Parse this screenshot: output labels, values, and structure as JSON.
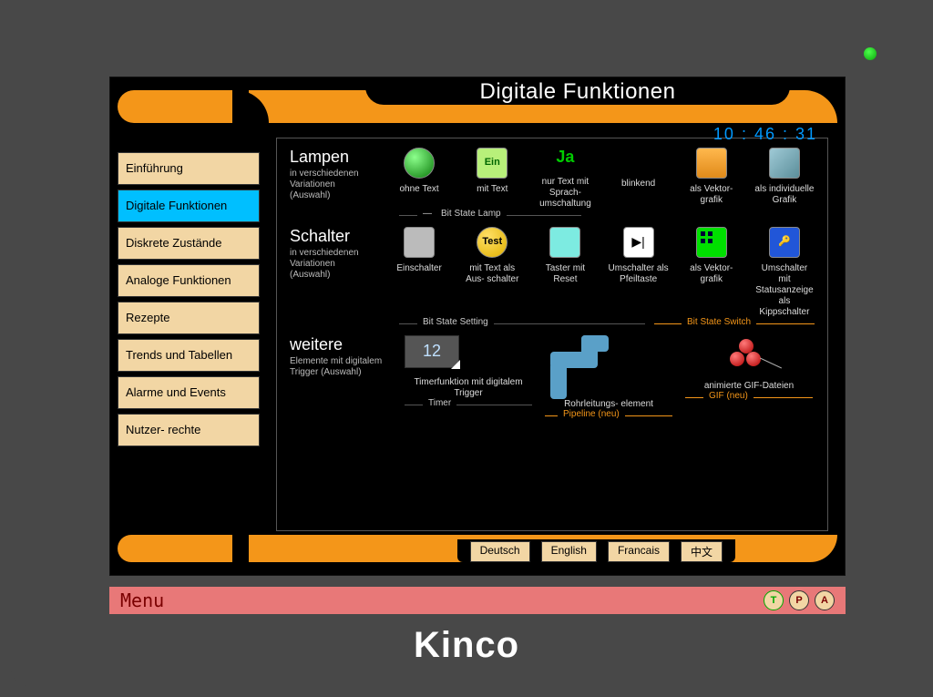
{
  "title": "Digitale Funktionen",
  "clock": "10 : 46 : 31",
  "sidebar": {
    "items": [
      {
        "label": "Einführung"
      },
      {
        "label": "Digitale Funktionen",
        "active": true
      },
      {
        "label": "Diskrete Zustände"
      },
      {
        "label": "Analoge Funktionen"
      },
      {
        "label": "Rezepte"
      },
      {
        "label": "Trends und Tabellen"
      },
      {
        "label": "Alarme und Events"
      },
      {
        "label": "Nutzer- rechte"
      }
    ]
  },
  "sections": {
    "lampen": {
      "title": "Lampen",
      "subtitle": "in verschiedenen Variationen (Auswahl)",
      "items": [
        {
          "label": "ohne Text"
        },
        {
          "label": "mit Text",
          "icon_text": "Ein"
        },
        {
          "label": "nur Text mit Sprach- umschaltung",
          "big": "Ja"
        },
        {
          "label": "blinkend"
        },
        {
          "label": "als Vektor- grafik"
        },
        {
          "label": "als individuelle Grafik"
        }
      ],
      "rule": "Bit State Lamp"
    },
    "schalter": {
      "title": "Schalter",
      "subtitle": "in verschiedenen Variationen (Auswahl)",
      "items": [
        {
          "label": "Einschalter"
        },
        {
          "label": "mit Text als Aus- schalter",
          "icon_text": "Test"
        },
        {
          "label": "Taster mit Reset"
        },
        {
          "label": "Umschalter als Pfeiltaste"
        },
        {
          "label": "als Vektor- grafik"
        },
        {
          "label": "Umschalter mit Statusanzeige als Kippschalter"
        }
      ],
      "rule_left": "Bit State Setting",
      "rule_right": "Bit State Switch"
    },
    "weitere": {
      "title": "weitere",
      "subtitle": "Elemente mit digitalem Trigger (Auswahl)",
      "items": [
        {
          "label": "Timerfunktion mit digitalem Trigger",
          "value": "12",
          "rule": "Timer"
        },
        {
          "label": "Rohrleitungs- element",
          "rule": "Pipeline (neu)"
        },
        {
          "label": "animierte GIF-Dateien",
          "rule": "GIF (neu)"
        }
      ]
    }
  },
  "languages": [
    "Deutsch",
    "English",
    "Francais",
    "中文"
  ],
  "menubar": {
    "menu": "Menu",
    "status": [
      "T",
      "P",
      "A"
    ]
  },
  "brand": "Kinco"
}
